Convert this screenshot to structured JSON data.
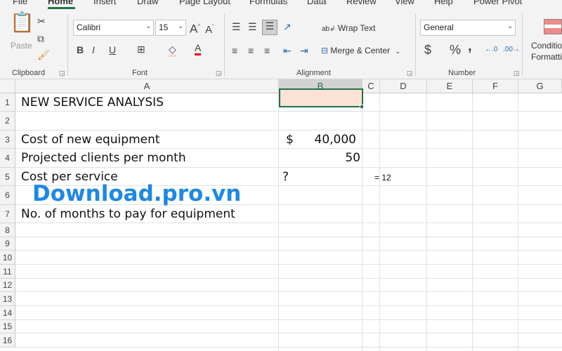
{
  "tabs": [
    "File",
    "Home",
    "Insert",
    "Draw",
    "Page Layout",
    "Formulas",
    "Data",
    "Review",
    "View",
    "Help",
    "Power Pivot"
  ],
  "ribbon": {
    "clipboard": {
      "paste_label": "Paste",
      "group_label": "Clipboard"
    },
    "font": {
      "font_name": "Calibri",
      "font_size": "15",
      "group_label": "Font",
      "bold": "B",
      "italic": "I",
      "underline": "U"
    },
    "alignment": {
      "wrap_text": "Wrap Text",
      "merge_center": "Merge & Center",
      "group_label": "Alignment"
    },
    "number": {
      "format": "General",
      "currency": "$",
      "percent": "%",
      "comma": ",",
      "group_label": "Number"
    },
    "styles": {
      "conditional_formatting_1": "Conditio",
      "conditional_formatting_2": "Formattin"
    }
  },
  "columns": [
    "A",
    "B",
    "C",
    "D",
    "E",
    "F",
    "G"
  ],
  "rows": [
    "1",
    "2",
    "3",
    "4",
    "5",
    "6",
    "7",
    "8",
    "9",
    "10",
    "11",
    "12",
    "13",
    "14",
    "15",
    "16"
  ],
  "cells": {
    "A1": "NEW SERVICE ANALYSIS",
    "A3": "Cost of new equipment",
    "B3_symbol": "$",
    "B3_value": "40,000",
    "A4": "Projected clients per month",
    "B4": "50",
    "A5": "Cost per service",
    "B5": "?",
    "C5_note": "= 12",
    "A7": "No. of months to pay for equipment"
  },
  "watermark": "Download.pro.vn",
  "colors": {
    "accent": "#217346",
    "selected_fill": "#fbe2d5"
  }
}
